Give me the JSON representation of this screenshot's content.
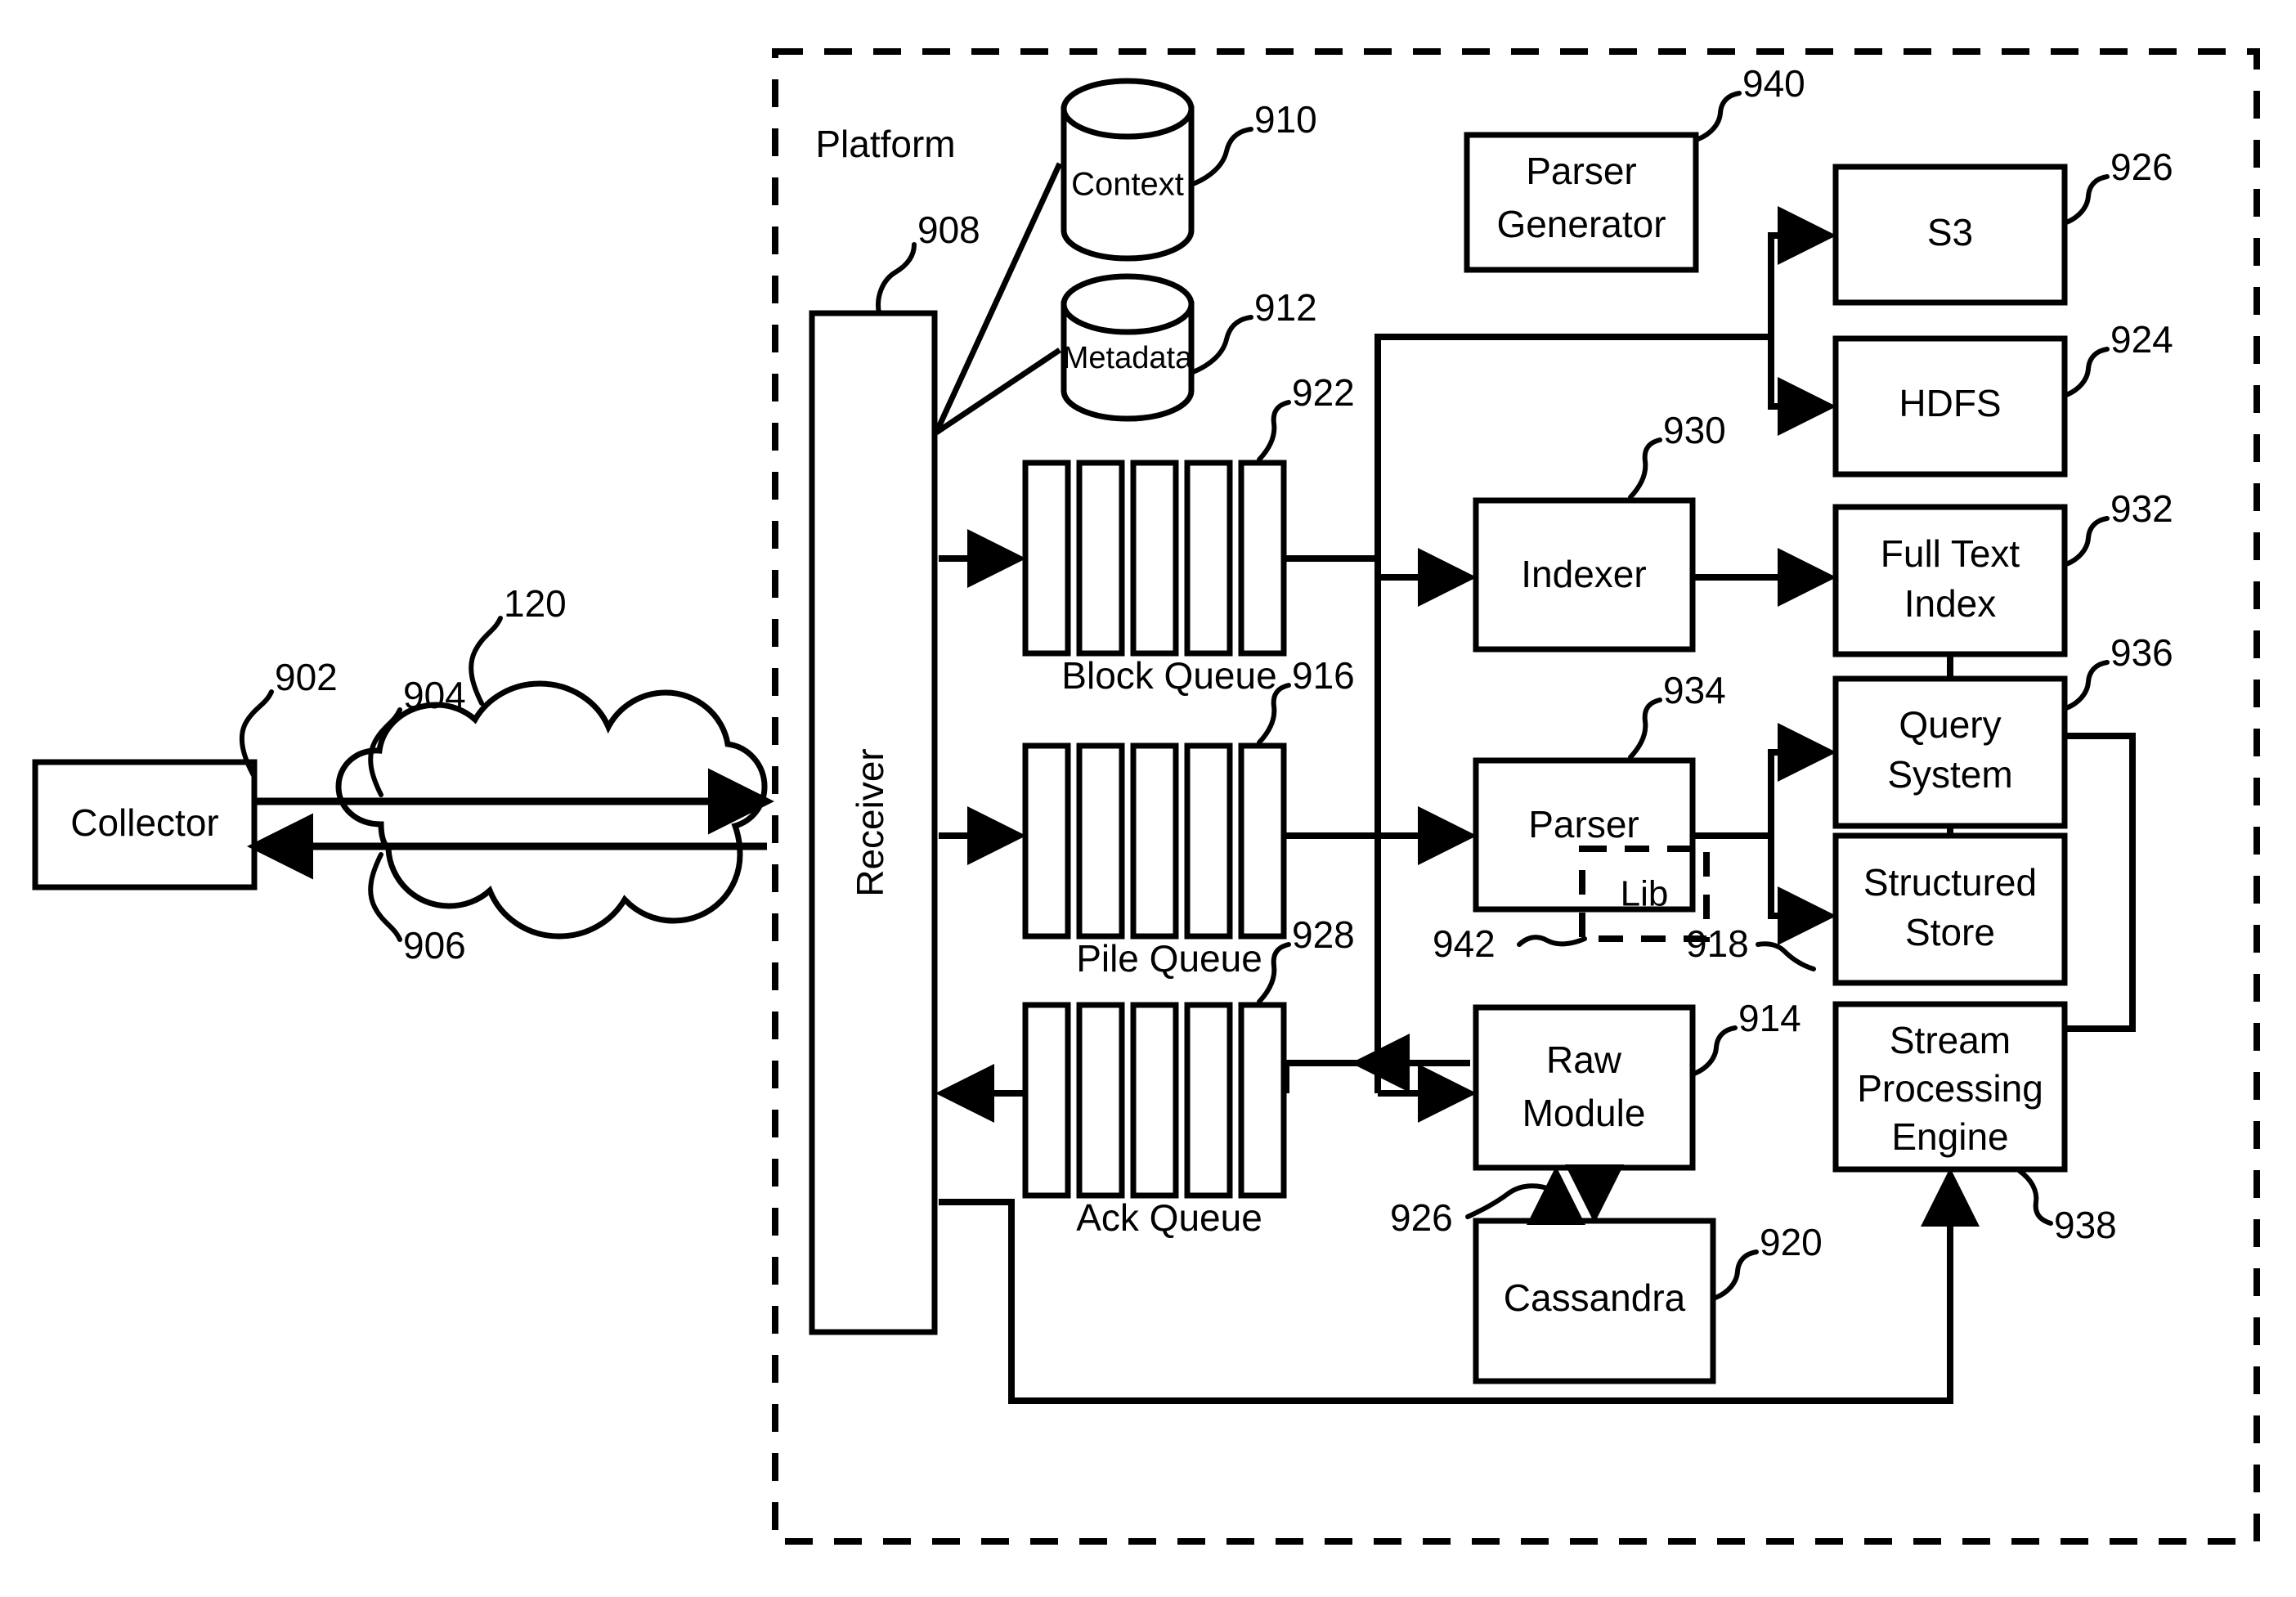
{
  "figure": {
    "type": "patent-system-block-diagram",
    "boundary_label": "Platform"
  },
  "external": {
    "collector": {
      "label": "Collector",
      "ref": "902"
    },
    "network_cloud": {
      "ref": "120"
    },
    "uplink_arrow_ref": "904",
    "downlink_arrow_ref": "906"
  },
  "platform": {
    "label": "Platform",
    "receiver": {
      "label": "Receiver",
      "ref": "908"
    },
    "stores": [
      {
        "label": "Context",
        "ref": "910",
        "shape": "cylinder"
      },
      {
        "label": "Metadata",
        "ref": "912",
        "shape": "cylinder"
      }
    ],
    "queues": [
      {
        "label": "Block Queue",
        "ref": "922",
        "slots": 5
      },
      {
        "label": "Pile Queue",
        "ref": "916",
        "slots": 5
      },
      {
        "label": "Ack Queue",
        "ref": "928",
        "slots": 5
      }
    ],
    "processors": [
      {
        "label": "Indexer",
        "ref": "930"
      },
      {
        "label": "Parser",
        "ref": "934"
      },
      {
        "label": "Raw Module",
        "ref": "914"
      },
      {
        "label": "Parser Generator",
        "ref": "940"
      },
      {
        "label": "Cassandra",
        "ref": "920"
      }
    ],
    "parser_lib": {
      "label": "Lib",
      "ref": "942",
      "style": "dashed"
    },
    "sinks": [
      {
        "label": "S3",
        "ref": "926"
      },
      {
        "label": "HDFS",
        "ref": "924"
      },
      {
        "label": "Full Text Index",
        "ref": "932"
      },
      {
        "label": "Query System",
        "ref": "936"
      },
      {
        "label": "Structured Store",
        "ref": "918"
      },
      {
        "label": "Stream Processing Engine",
        "ref": "938"
      }
    ],
    "raw_cassandra_link_ref": "926"
  },
  "labels": {
    "collector": "Collector",
    "platform": "Platform",
    "receiver": "Receiver",
    "context": "Context",
    "metadata": "Metadata",
    "block_queue": "Block Queue",
    "pile_queue": "Pile Queue",
    "ack_queue": "Ack Queue",
    "indexer": "Indexer",
    "parser": "Parser",
    "lib": "Lib",
    "raw_module_line1": "Raw",
    "raw_module_line2": "Module",
    "parser_generator_line1": "Parser",
    "parser_generator_line2": "Generator",
    "cassandra": "Cassandra",
    "s3": "S3",
    "hdfs": "HDFS",
    "full_text_index_line1": "Full Text",
    "full_text_index_line2": "Index",
    "query_system_line1": "Query",
    "query_system_line2": "System",
    "structured_store_line1": "Structured",
    "structured_store_line2": "Store",
    "spe_line1": "Stream",
    "spe_line2": "Processing",
    "spe_line3": "Engine"
  },
  "refs": {
    "r120": "120",
    "r902": "902",
    "r904": "904",
    "r906": "906",
    "r908": "908",
    "r910": "910",
    "r912": "912",
    "r914": "914",
    "r916": "916",
    "r918": "918",
    "r920": "920",
    "r922": "922",
    "r924": "924",
    "r926_s3": "926",
    "r926_cass": "926",
    "r928": "928",
    "r930": "930",
    "r932": "932",
    "r934": "934",
    "r936": "936",
    "r938": "938",
    "r940": "940",
    "r942": "942"
  },
  "colors": {
    "ink": "#000000",
    "paper": "#ffffff"
  }
}
